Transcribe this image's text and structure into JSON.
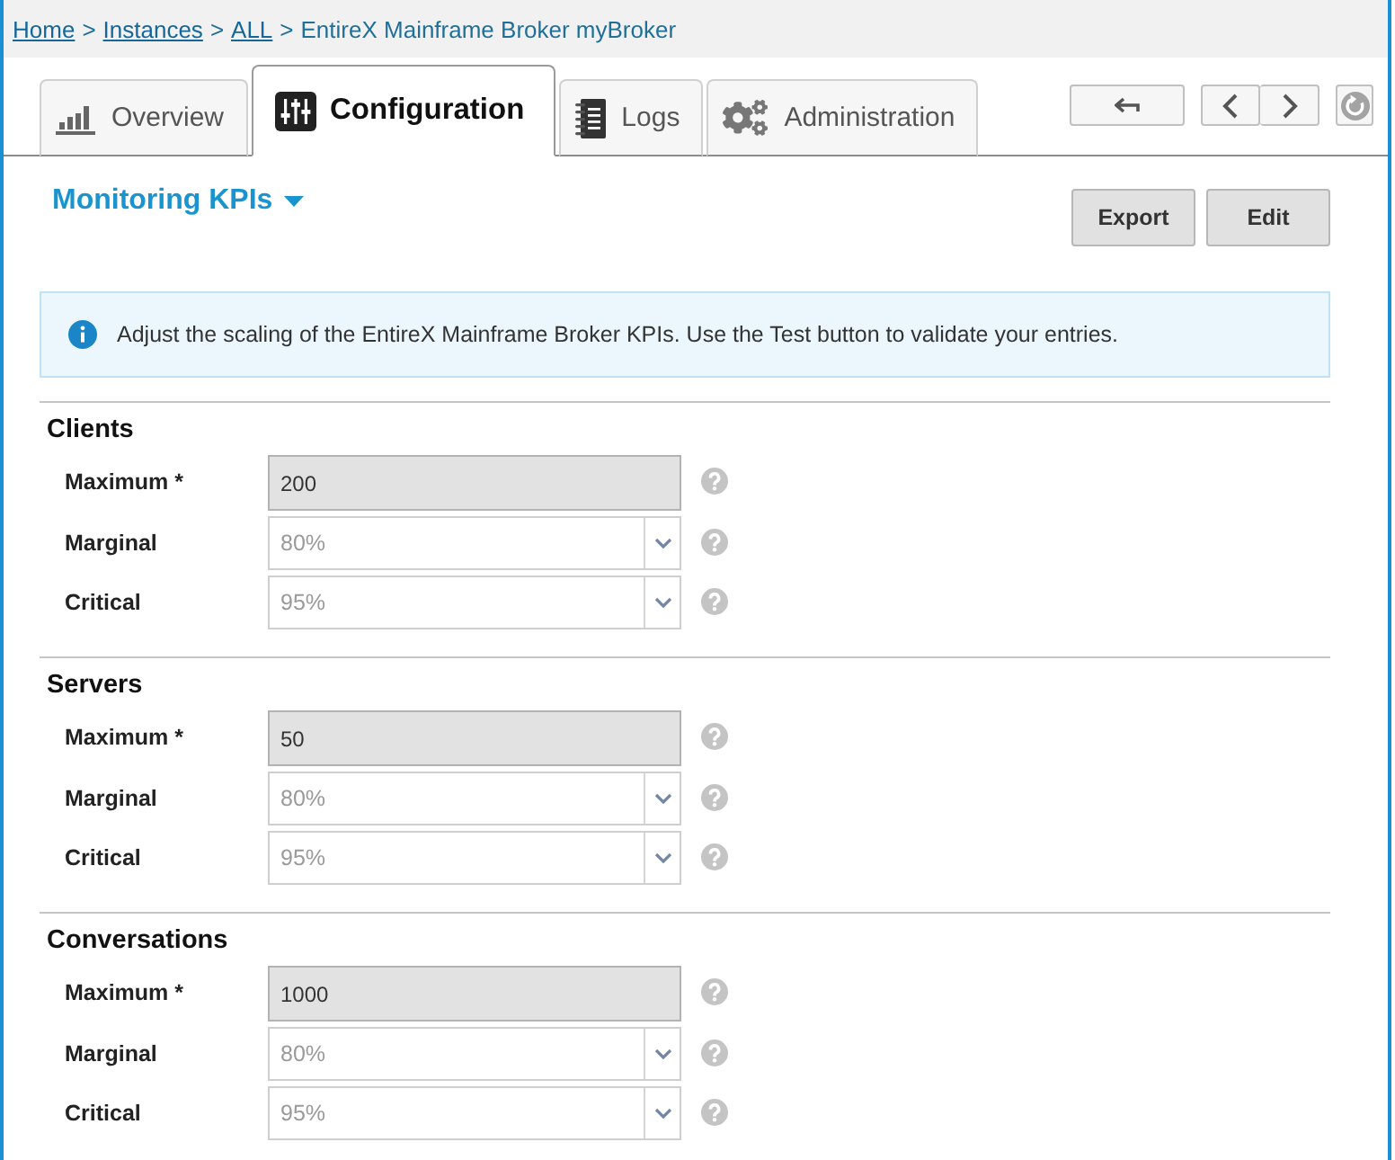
{
  "breadcrumb": [
    {
      "kind": "link",
      "label": "Home"
    },
    {
      "kind": "separator",
      "label": ">"
    },
    {
      "kind": "link",
      "label": "Instances"
    },
    {
      "kind": "separator",
      "label": ">"
    },
    {
      "kind": "link",
      "label": "ALL"
    },
    {
      "kind": "separator",
      "label": ">"
    },
    {
      "kind": "current",
      "label": "EntireX Mainframe Broker myBroker"
    }
  ],
  "tabs": [
    {
      "label": "Overview",
      "selected": false
    },
    {
      "label": "Configuration",
      "selected": true
    },
    {
      "label": "Logs",
      "selected": false
    },
    {
      "label": "Administration",
      "selected": false
    }
  ],
  "view_menu": {
    "label": "Monitoring KPIs"
  },
  "actions": [
    {
      "label": "Export"
    },
    {
      "label": "Edit"
    }
  ],
  "info": {
    "text": "Adjust the scaling of the EntireX Mainframe Broker KPIs. Use the Test button to validate your entries."
  },
  "sections": [
    {
      "title": "Clients",
      "fields": [
        {
          "label": "Maximum *",
          "kind": "input",
          "value": "200",
          "disabled": true
        },
        {
          "label": "Marginal",
          "kind": "select",
          "value": "80%",
          "disabled": true
        },
        {
          "label": "Critical",
          "kind": "select",
          "value": "95%",
          "disabled": true
        }
      ]
    },
    {
      "title": "Servers",
      "fields": [
        {
          "label": "Maximum *",
          "kind": "input",
          "value": "50",
          "disabled": true
        },
        {
          "label": "Marginal",
          "kind": "select",
          "value": "80%",
          "disabled": true
        },
        {
          "label": "Critical",
          "kind": "select",
          "value": "95%",
          "disabled": true
        }
      ]
    },
    {
      "title": "Conversations",
      "fields": [
        {
          "label": "Maximum *",
          "kind": "input",
          "value": "1000",
          "disabled": true
        },
        {
          "label": "Marginal",
          "kind": "select",
          "value": "80%",
          "disabled": true
        },
        {
          "label": "Critical",
          "kind": "select",
          "value": "95%",
          "disabled": true
        }
      ]
    }
  ]
}
